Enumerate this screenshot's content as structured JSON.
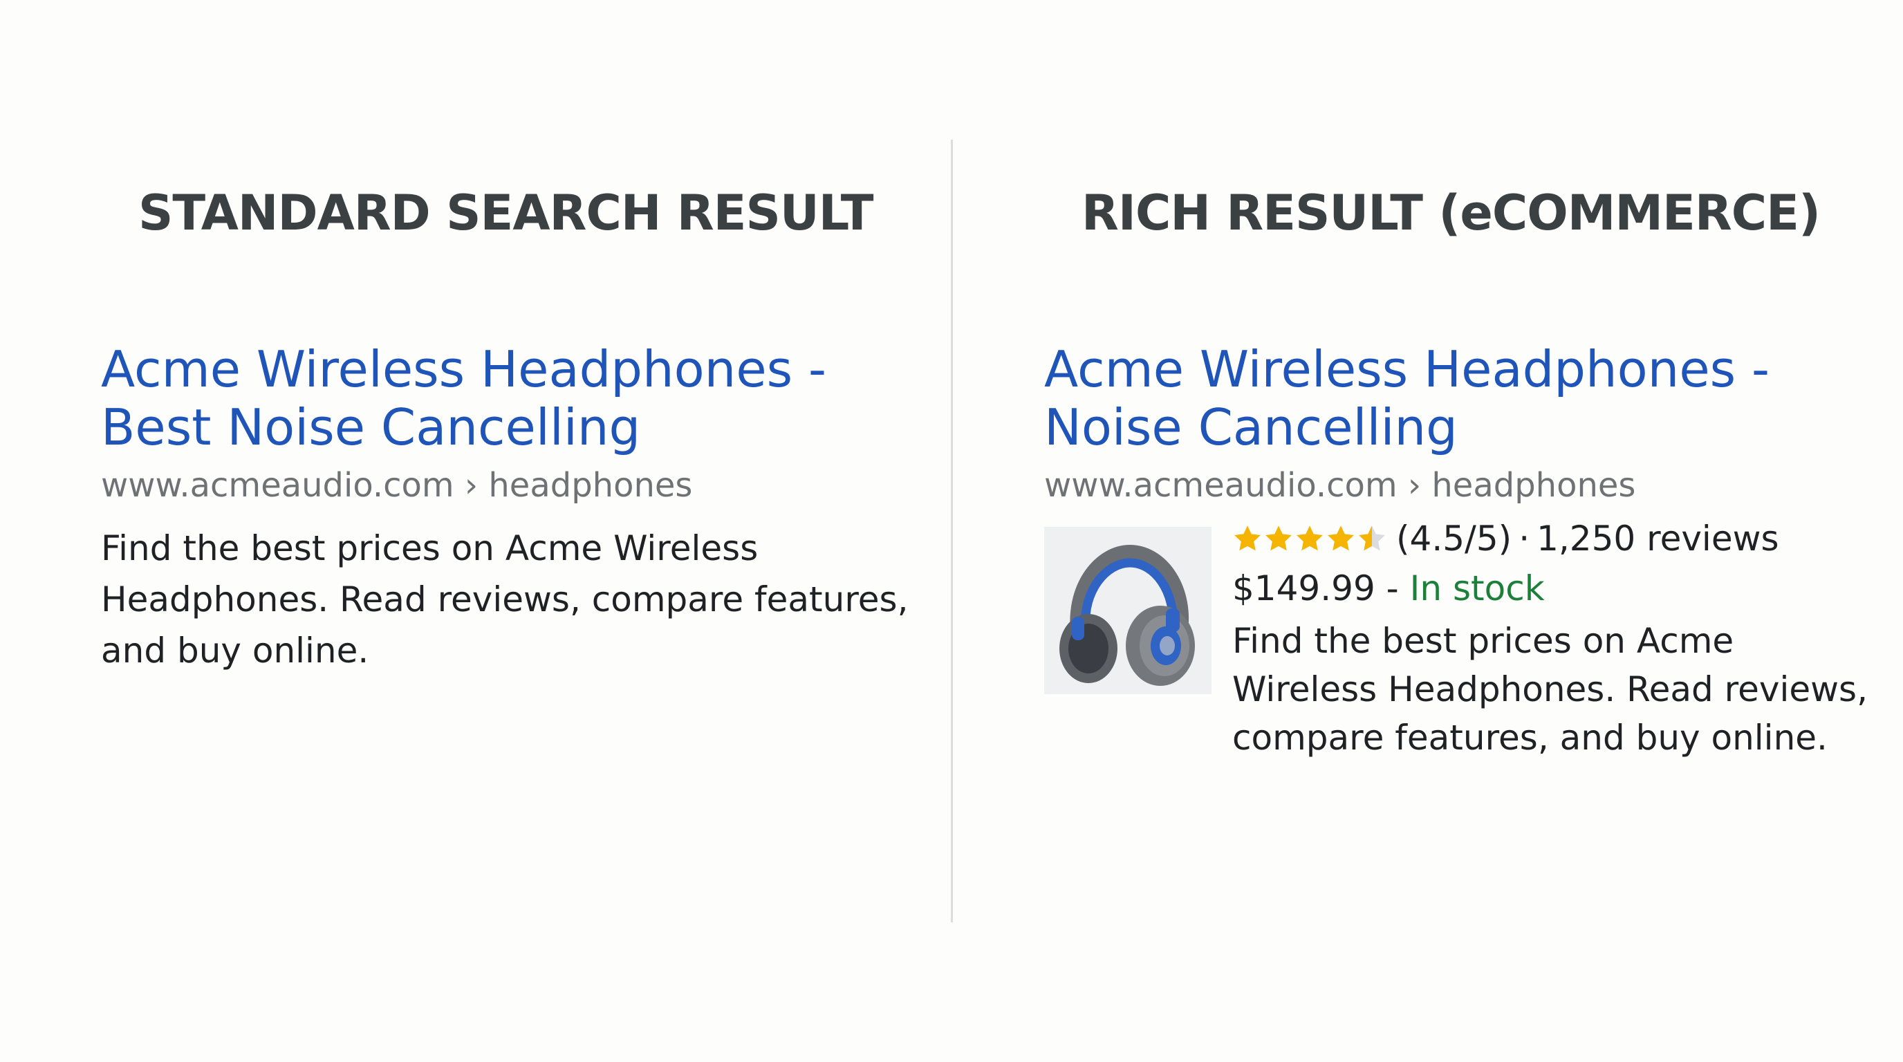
{
  "standard": {
    "heading": "STANDARD SEARCH RESULT",
    "title_lines": [
      "Acme Wireless Headphones -",
      "Best Noise Cancelling"
    ],
    "url": "www.acmeaudio.com › headphones",
    "snippet_lines": [
      "Find the best prices on Acme Wireless",
      "Headphones. Read reviews, compare features,",
      "and buy online."
    ]
  },
  "rich": {
    "heading": "RICH RESULT (eCOMMERCE)",
    "title_lines": [
      "Acme Wireless Headphones -",
      "Noise Cancelling"
    ],
    "url": "www.acmeaudio.com › headphones",
    "rating_value": 4.5,
    "rating_max": 5,
    "rating_text": "(4.5/5)",
    "separator": "·",
    "reviews_text": "1,250 reviews",
    "price": "$149.99",
    "price_separator": "-",
    "stock": "In stock",
    "thumbnail_icon": "headphones-icon",
    "snippet_lines": [
      "Find the best prices on Acme",
      "Wireless Headphones. Read reviews,",
      "compare features, and buy online."
    ]
  },
  "colors": {
    "link": "#1f55b9",
    "url": "#6f7275",
    "heading": "#3b4043",
    "body": "#202124",
    "stock": "#1c7f3a",
    "star": "#f4b400",
    "star_empty": "#dadce0",
    "divider": "#dcdcdc"
  }
}
